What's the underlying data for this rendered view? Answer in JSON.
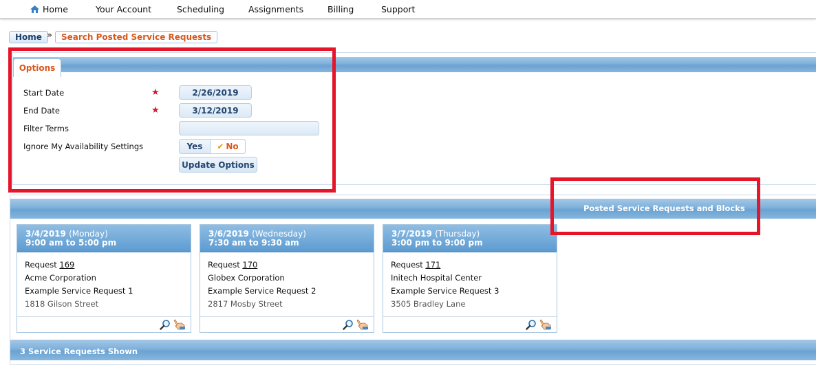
{
  "nav": {
    "items": [
      "Home",
      "Your Account",
      "Scheduling",
      "Assignments",
      "Billing",
      "Support"
    ]
  },
  "breadcrumb": {
    "home": "Home",
    "separator": "»",
    "current": "Search Posted Service Requests"
  },
  "options": {
    "tab_label": "Options",
    "start_date_label": "Start Date",
    "start_date_value": "2/26/2019",
    "end_date_label": "End Date",
    "end_date_value": "3/12/2019",
    "filter_terms_label": "Filter Terms",
    "filter_terms_value": "",
    "ignore_label": "Ignore My Availability Settings",
    "yes_label": "Yes",
    "no_label": "No",
    "selected": "No",
    "update_button": "Update Options"
  },
  "results": {
    "title": "Posted Service Requests and Blocks",
    "footer": "3 Service Requests Shown",
    "cards": [
      {
        "date": "3/4/2019",
        "day": "(Monday)",
        "time": "9:00 am to 5:00 pm",
        "request_prefix": "Request",
        "request_id": "169",
        "organization": "Acme Corporation",
        "description": "Example Service Request 1",
        "address": "1818 Gilson Street"
      },
      {
        "date": "3/6/2019",
        "day": "(Wednesday)",
        "time": "7:30 am to 9:30 am",
        "request_prefix": "Request",
        "request_id": "170",
        "organization": "Globex Corporation",
        "description": "Example Service Request 2",
        "address": "2817 Mosby Street"
      },
      {
        "date": "3/7/2019",
        "day": "(Thursday)",
        "time": "3:00 pm to 9:00 pm",
        "request_prefix": "Request",
        "request_id": "171",
        "organization": "Initech Hospital Center",
        "description": "Example Service Request 3",
        "address": "3505 Bradley Lane"
      }
    ]
  },
  "colors": {
    "accent_orange": "#d9581c",
    "header_blue": "#6aa2d2",
    "annotation_red": "#e5162a",
    "required_star": "#d8142a"
  },
  "icons": [
    "home-icon",
    "required-star-icon",
    "checkmark-icon",
    "magnifier-icon",
    "hand-pointer-icon"
  ]
}
